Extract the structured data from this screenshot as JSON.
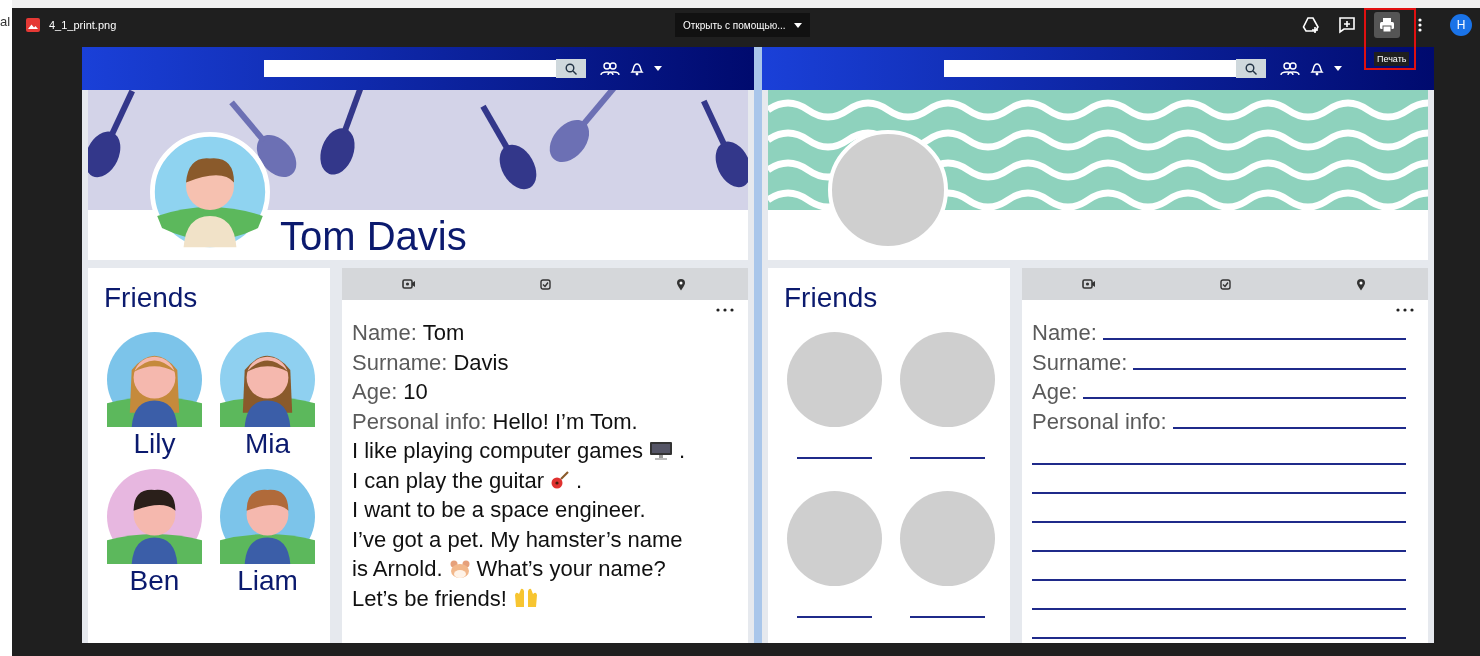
{
  "background_page": {
    "text": "al"
  },
  "viewer": {
    "file_name": "4_1_print.png",
    "open_with": "Открыть с помощью...",
    "tooltip": "Печать",
    "account_letter": "H"
  },
  "pages": [
    {
      "kind": "filled",
      "name": "Tom Davis",
      "friends_title": "Friends",
      "friends": [
        {
          "name": "Lily",
          "kind": "girl"
        },
        {
          "name": "Mia",
          "kind": "girl"
        },
        {
          "name": "Ben",
          "kind": "boy"
        },
        {
          "name": "Liam",
          "kind": "boy"
        }
      ],
      "fields": [
        {
          "label": "Name:",
          "value": "Tom"
        },
        {
          "label": "Surname:",
          "value": "Davis"
        },
        {
          "label": "Age:",
          "value": "10"
        },
        {
          "label": "Personal info:",
          "value": "Hello! I’m Tom."
        }
      ],
      "info_lines": [
        {
          "kind": "monitor",
          "before": "I like playing computer games",
          "after": "."
        },
        {
          "kind": "guitar",
          "before": "I can play the guitar",
          "after": "."
        },
        {
          "kind": "plain",
          "before": "I want to be a space engineer."
        },
        {
          "kind": "plain",
          "before": "I’ve got a pet. My hamster’s name"
        },
        {
          "kind": "hamster",
          "before": "is Arnold.",
          "after": "What’s your name?"
        },
        {
          "kind": "hands",
          "before": "Let’s be friends!"
        }
      ]
    },
    {
      "kind": "blank",
      "friends_title": "Friends",
      "friends": [
        {
          "kind": "blank"
        },
        {
          "kind": "blank"
        },
        {
          "kind": "blank"
        },
        {
          "kind": "blank"
        }
      ],
      "fields": [
        {
          "label": "Name:"
        },
        {
          "label": "Surname:"
        },
        {
          "label": "Age:"
        },
        {
          "label": "Personal info:"
        }
      ],
      "writing_lines": [
        {
          "kind": "line"
        },
        {
          "kind": "line"
        },
        {
          "kind": "line"
        },
        {
          "kind": "line"
        },
        {
          "kind": "line"
        },
        {
          "kind": "line"
        },
        {
          "kind": "line"
        }
      ]
    }
  ]
}
